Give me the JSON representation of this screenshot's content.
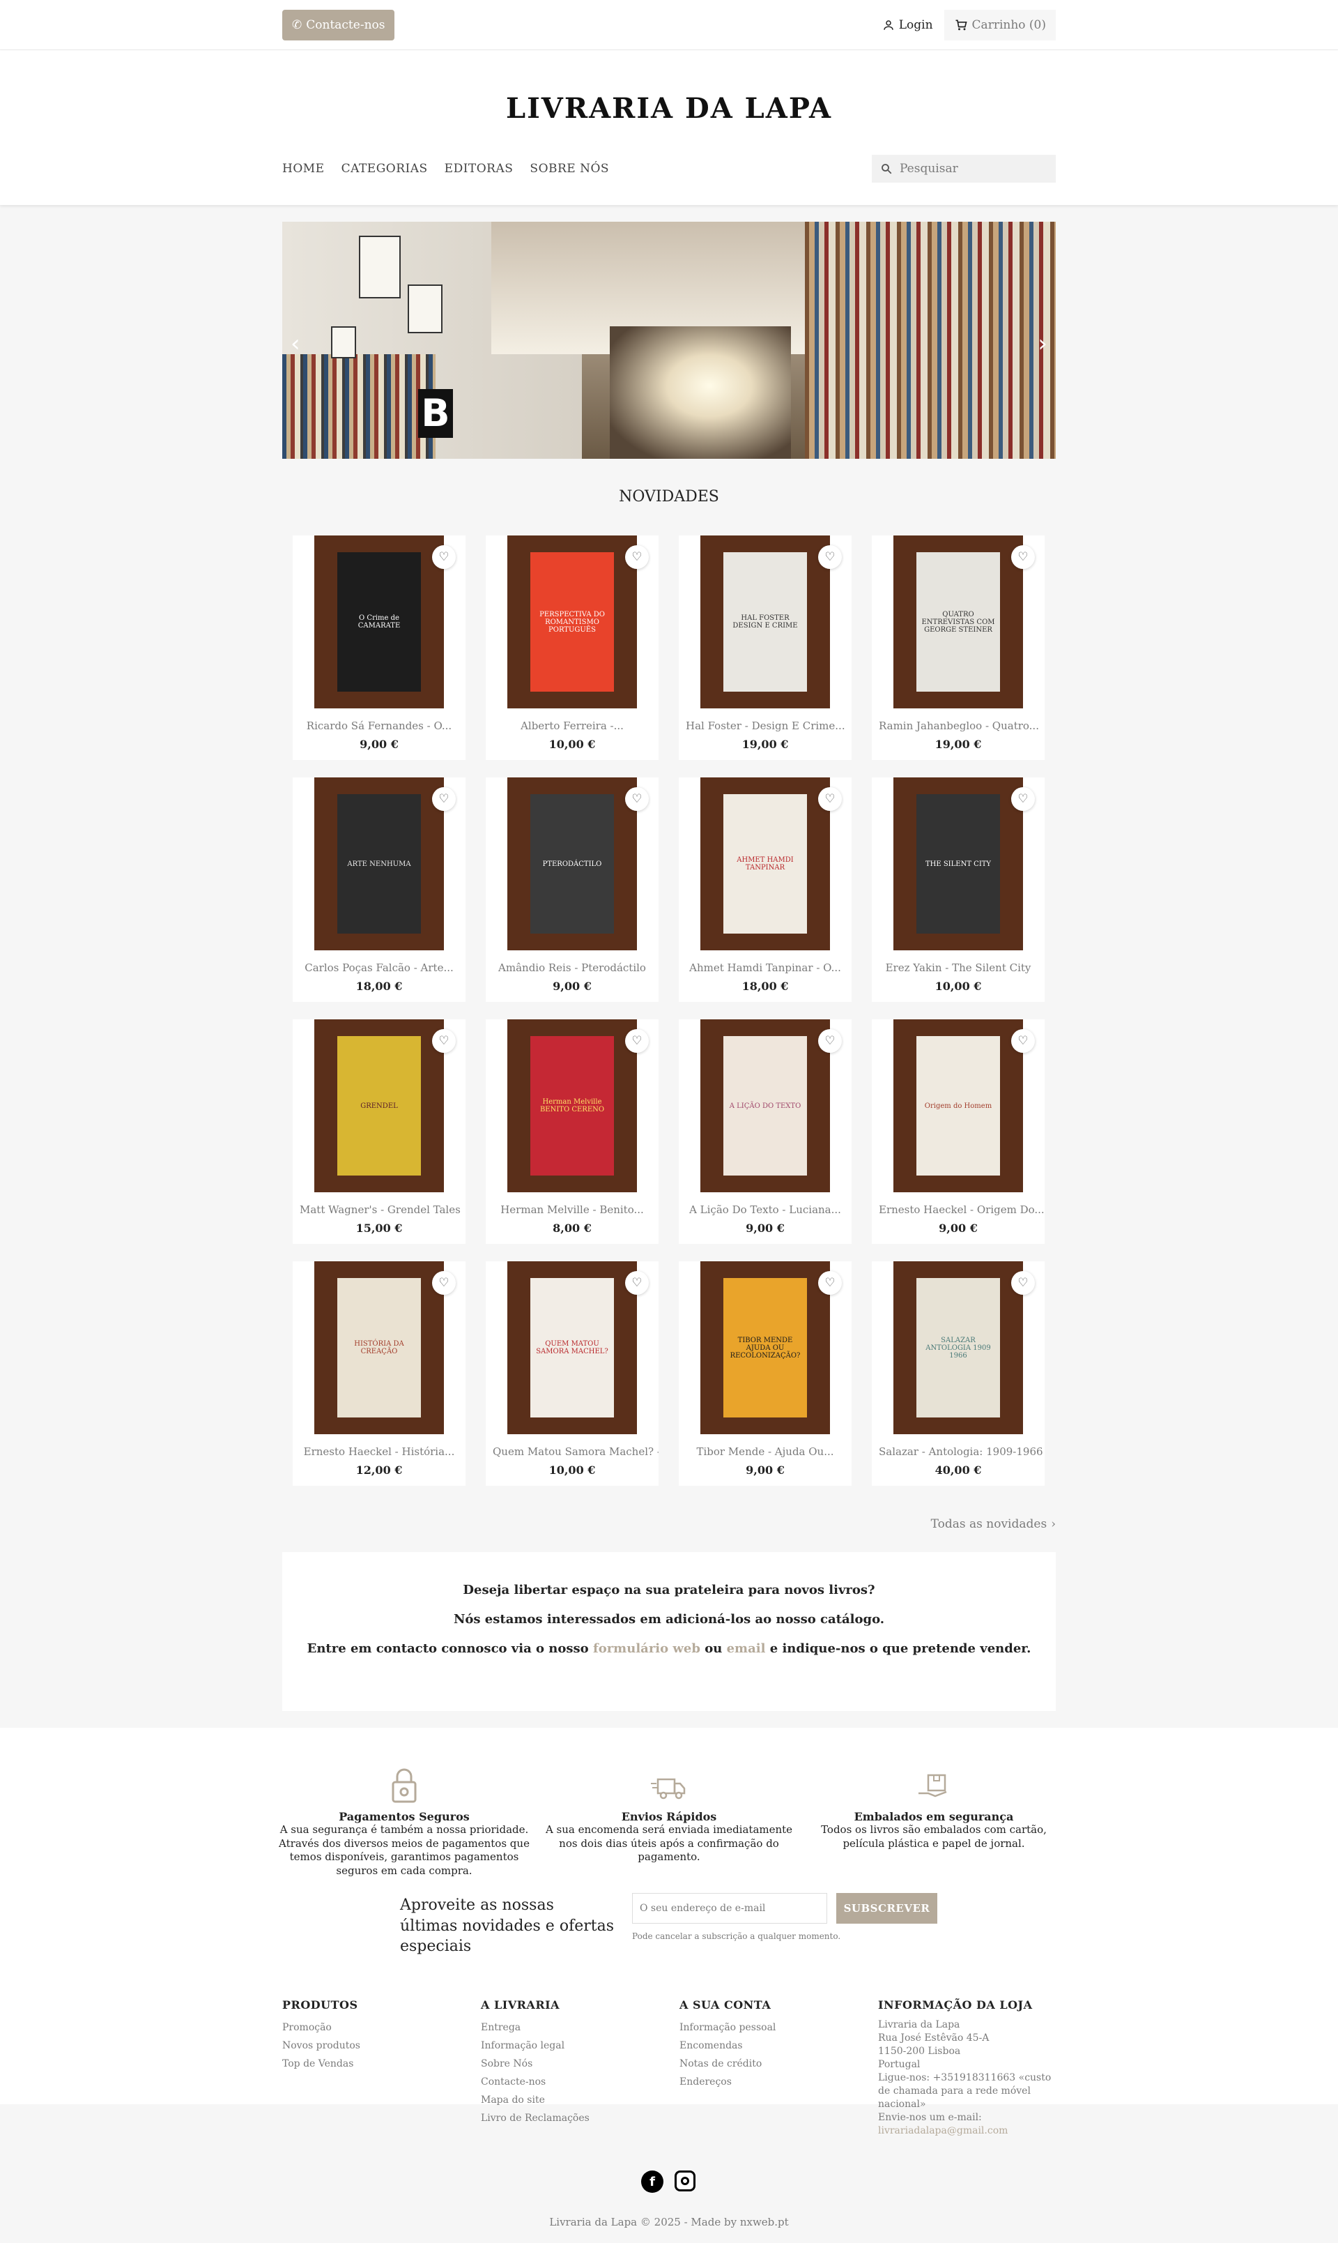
{
  "topbar": {
    "contact_label": "Contacte-nos",
    "login_label": "Login",
    "cart_label": "Carrinho (0)"
  },
  "header": {
    "logo": "LIVRARIA DA LAPA",
    "menu": [
      "HOME",
      "CATEGORIAS",
      "EDITORAS",
      "SOBRE NÓS"
    ],
    "search_placeholder": "Pesquisar"
  },
  "carousel": {
    "prev": "‹",
    "next": "›"
  },
  "section_title": "NOVIDADES",
  "products": [
    {
      "title": "Ricardo Sá Fernandes - O...",
      "price": "9,00 €",
      "cover": "O Crime de CAMARATE",
      "bg": "#1d1d1d",
      "fg": "#ffffff"
    },
    {
      "title": "Alberto Ferreira -...",
      "price": "10,00 €",
      "cover": "PERSPECTIVA DO ROMANTISMO PORTUGUÊS",
      "bg": "#e8432b",
      "fg": "#ffffff"
    },
    {
      "title": "Hal Foster - Design E Crime...",
      "price": "19,00 €",
      "cover": "HAL FOSTER DESIGN E CRIME",
      "bg": "#e9e7e1",
      "fg": "#333333"
    },
    {
      "title": "Ramin Jahanbegloo - Quatro...",
      "price": "19,00 €",
      "cover": "QUATRO ENTREVISTAS COM GEORGE STEINER",
      "bg": "#e6e4de",
      "fg": "#333333"
    },
    {
      "title": "Carlos Poças Falcão - Arte...",
      "price": "18,00 €",
      "cover": "ARTE NENHUMA",
      "bg": "#2c2c2c",
      "fg": "#e8e8e8"
    },
    {
      "title": "Amândio Reis - Pterodáctilo",
      "price": "9,00 €",
      "cover": "PTERODÁCTILO",
      "bg": "#3a3a3a",
      "fg": "#ffffff"
    },
    {
      "title": "Ahmet Hamdi Tanpinar - O...",
      "price": "18,00 €",
      "cover": "AHMET HAMDI TANPINAR",
      "bg": "#f0ebe2",
      "fg": "#b8272b"
    },
    {
      "title": "Erez Yakin - The Silent City",
      "price": "10,00 €",
      "cover": "THE SILENT CITY",
      "bg": "#333333",
      "fg": "#ffffff"
    },
    {
      "title": "Matt Wagner's - Grendel Tales",
      "price": "15,00 €",
      "cover": "GRENDEL",
      "bg": "#d8b632",
      "fg": "#5a1d2a"
    },
    {
      "title": "Herman Melville - Benito...",
      "price": "8,00 €",
      "cover": "Herman Melville BENITO CERENO",
      "bg": "#c52834",
      "fg": "#ffe066"
    },
    {
      "title": "A Lição Do Texto - Luciana...",
      "price": "9,00 €",
      "cover": "A LIÇÃO DO TEXTO",
      "bg": "#efe6dc",
      "fg": "#a0476a"
    },
    {
      "title": "Ernesto Haeckel - Origem Do...",
      "price": "9,00 €",
      "cover": "Origem do Homem",
      "bg": "#efeae0",
      "fg": "#a23d2b"
    },
    {
      "title": "Ernesto Haeckel - História...",
      "price": "12,00 €",
      "cover": "HISTÓRIA DA CREAÇÃO",
      "bg": "#eae2d2",
      "fg": "#a23d2b"
    },
    {
      "title": "Quem Matou Samora Machel? -...",
      "price": "10,00 €",
      "cover": "QUEM MATOU SAMORA MACHEL?",
      "bg": "#f2ede6",
      "fg": "#b8272b"
    },
    {
      "title": "Tibor Mende - Ajuda Ou...",
      "price": "9,00 €",
      "cover": "TIBOR MENDE AJUDA OU RECOLONIZAÇÃO?",
      "bg": "#e9a42b",
      "fg": "#1a1a1a"
    },
    {
      "title": "Salazar - Antologia: 1909-1966",
      "price": "40,00 €",
      "cover": "SALAZAR ANTOLOGIA 1909 1966",
      "bg": "#e7e2d5",
      "fg": "#4a7a78"
    }
  ],
  "all_new_label": "Todas as novidades",
  "info": {
    "line1": "Deseja libertar espaço na sua prateleira para novos livros?",
    "line2": "Nós estamos interessados em adicioná-los ao nosso catálogo.",
    "line3_a": "Entre em contacto connosco via o nosso",
    "line3_link1": "formulário web",
    "line3_b": "ou",
    "line3_link2": "email",
    "line3_c": "e indique-nos o que pretende vender."
  },
  "reassurance": [
    {
      "title": "Pagamentos Seguros",
      "desc": "A sua segurança é também a nossa prioridade. Através dos diversos meios de pagamentos que temos disponíveis, garantimos pagamentos seguros em cada compra.",
      "icon": "lock-icon"
    },
    {
      "title": "Envios Rápidos",
      "desc": "A sua encomenda será enviada imediatamente nos dois dias úteis após a confirmação do pagamento.",
      "icon": "truck-icon"
    },
    {
      "title": "Embalados em segurança",
      "desc": "Todos os livros são embalados com cartão, película plástica e papel de jornal.",
      "icon": "package-icon"
    }
  ],
  "newsletter": {
    "text": "Aproveite as nossas últimas novidades e ofertas especiais",
    "placeholder": "O seu endereço de e-mail",
    "button": "SUBSCREVER",
    "note": "Pode cancelar a subscrição a qualquer momento."
  },
  "footer": {
    "col1_title": "PRODUTOS",
    "col1": [
      "Promoção",
      "Novos produtos",
      "Top de Vendas"
    ],
    "col2_title": "A LIVRARIA",
    "col2": [
      "Entrega",
      "Informação legal",
      "Sobre Nós",
      "Contacte-nos",
      "Mapa do site",
      "Livro de Reclamações"
    ],
    "col3_title": "A SUA CONTA",
    "col3": [
      "Informação pessoal",
      "Encomendas",
      "Notas de crédito",
      "Endereços"
    ],
    "col4_title": "INFORMAÇÃO DA LOJA",
    "store_lines": [
      "Livraria da Lapa",
      "Rua José Estêvão 45-A",
      "1150-200 Lisboa",
      "Portugal",
      "Ligue-nos: +351918311663 «custo de chamada para a rede móvel nacional»",
      "Envie-nos um e-mail:"
    ],
    "store_email": "livrariadalapa@gmail.com",
    "copyright": "Livraria da Lapa © 2025 - Made by nxweb.pt"
  }
}
